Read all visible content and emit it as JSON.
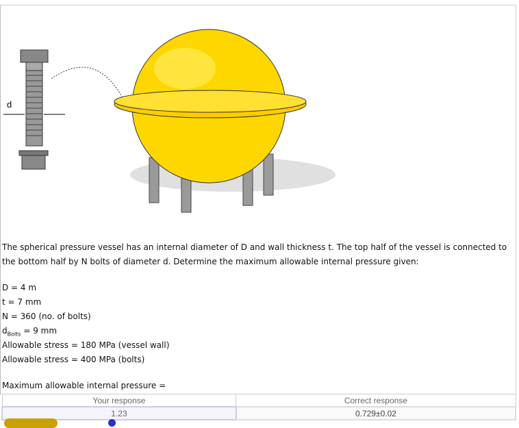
{
  "figure": {
    "dimension_label": "d"
  },
  "problem": {
    "paragraph": "The spherical pressure vessel has an internal diameter of D and wall thickness t.  The top half of the vessel is connected to the bottom half by N bolts of diameter d.  Determine the maximum allowable internal pressure given:",
    "givens": [
      "D = 4 m",
      "t = 7 mm",
      "N = 360 (no. of bolts)"
    ],
    "d_bolts": {
      "symbol": "d",
      "subscript": "Bolts",
      "value": " = 9 mm"
    },
    "stresses": [
      "Allowable stress = 180 MPa (vessel wall)",
      "Allowable stress = 400 MPa (bolts)"
    ],
    "question": "Maximum allowable internal pressure ="
  },
  "response_table": {
    "headers": [
      "Your response",
      "Correct response"
    ],
    "your_response": "1.23",
    "correct_response": "0.729±0.02"
  }
}
